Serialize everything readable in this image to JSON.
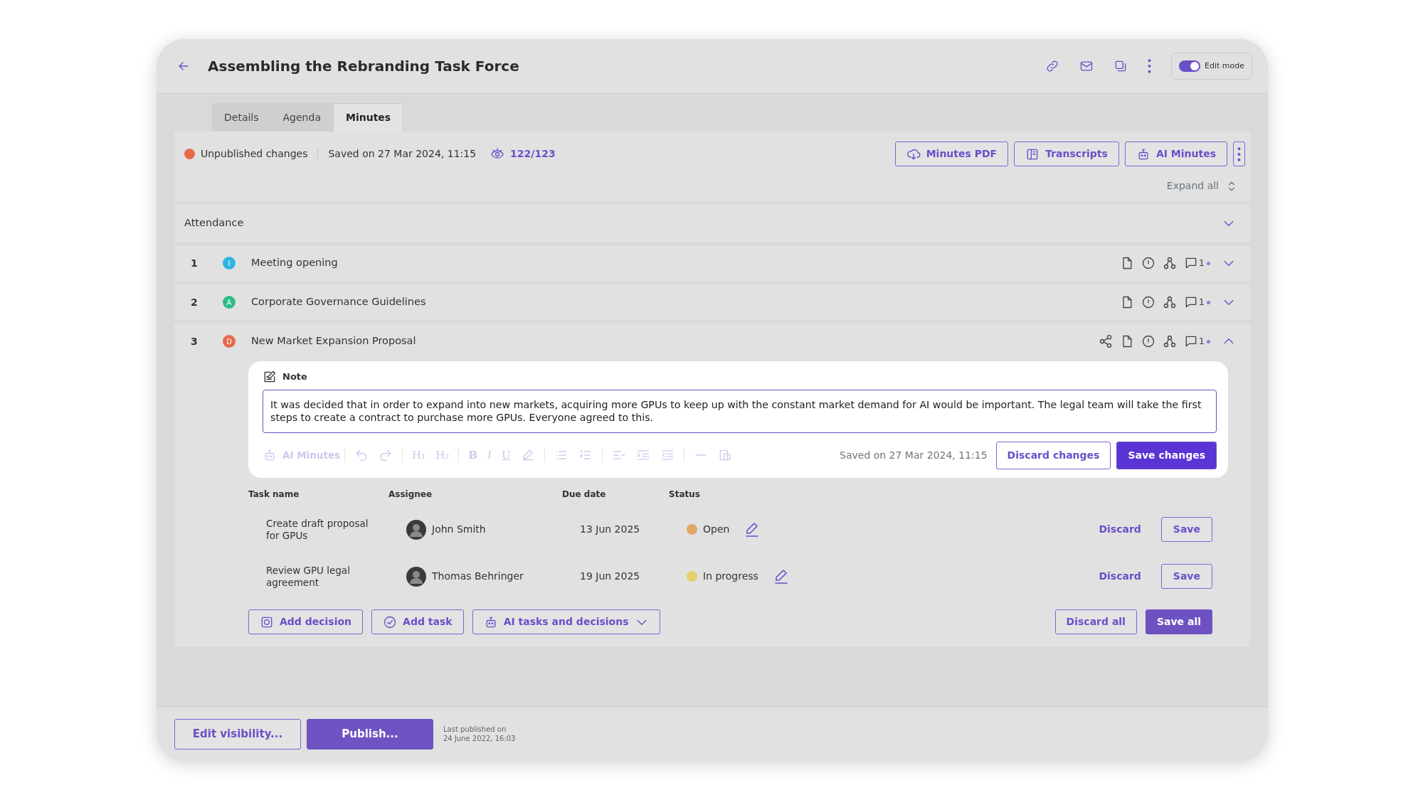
{
  "header": {
    "title": "Assembling the Rebranding Task Force",
    "edit_mode": {
      "label": "Edit mode",
      "on": true
    }
  },
  "tabs": [
    {
      "label": "Details",
      "selected": false
    },
    {
      "label": "Agenda",
      "selected": false
    },
    {
      "label": "Minutes",
      "selected": true
    }
  ],
  "status": {
    "unpublished": "Unpublished changes",
    "saved": "Saved on 27 Mar 2024, 11:15",
    "views": "122/123"
  },
  "toolbar_buttons": [
    {
      "label": "Minutes PDF",
      "kind": "pdf"
    },
    {
      "label": "Transcripts",
      "kind": "transcripts"
    },
    {
      "label": "AI Minutes",
      "kind": "ai"
    }
  ],
  "expand_all": "Expand all",
  "attendance": {
    "label": "Attendance",
    "expanded": false
  },
  "agenda_items": [
    {
      "number": "1",
      "initial": "I",
      "color": "#2bb5e0",
      "title": "Meeting opening",
      "comments": "1",
      "shared": false,
      "expanded": false
    },
    {
      "number": "2",
      "initial": "A",
      "color": "#2ebd85",
      "title": "Corporate Governance Guidelines",
      "comments": "1",
      "shared": false,
      "expanded": false
    },
    {
      "number": "3",
      "initial": "D",
      "color": "#e8684a",
      "title": "New Market Expansion Proposal",
      "comments": "1",
      "shared": true,
      "expanded": true
    }
  ],
  "note": {
    "title": "Note",
    "text": "It was decided that in order to expand into new markets, acquiring more GPUs to keep up with the constant market demand for AI would be important. The legal team will take the first steps to create a contract to purchase more GPUs. Everyone agreed to this.",
    "ai_minutes": "AI Minutes",
    "tools_disabled": true,
    "format_labels": [
      "H₁",
      "H₂",
      "B",
      "I",
      "U"
    ],
    "saved": "Saved on 27 Mar 2024, 11:15",
    "discard": "Discard changes",
    "save": "Save changes"
  },
  "tasks": {
    "columns": [
      "Task name",
      "Assignee",
      "Due date",
      "Status"
    ],
    "rows": [
      {
        "name": "Create draft proposal for GPUs",
        "assignee": "John Smith",
        "due": "13 Jun 2025",
        "status": "Open",
        "color": "#e0a868",
        "discard": "Discard",
        "save": "Save"
      },
      {
        "name": "Review GPU legal agreement",
        "assignee": "Thomas Behringer",
        "due": "19 Jun 2025",
        "status": "In progress",
        "color": "#e5cf6a",
        "discard": "Discard",
        "save": "Save"
      }
    ]
  },
  "actions": [
    {
      "label": "Add decision",
      "kind": "decision"
    },
    {
      "label": "Add task",
      "kind": "task"
    },
    {
      "label": "AI tasks and decisions",
      "kind": "ai"
    }
  ],
  "bulk": {
    "discard": "Discard all",
    "save": "Save all"
  },
  "footer": {
    "edit_visibility": "Edit visibility...",
    "publish": "Publish...",
    "last_published": "Last published on\n24 June 2022, 16:03"
  }
}
